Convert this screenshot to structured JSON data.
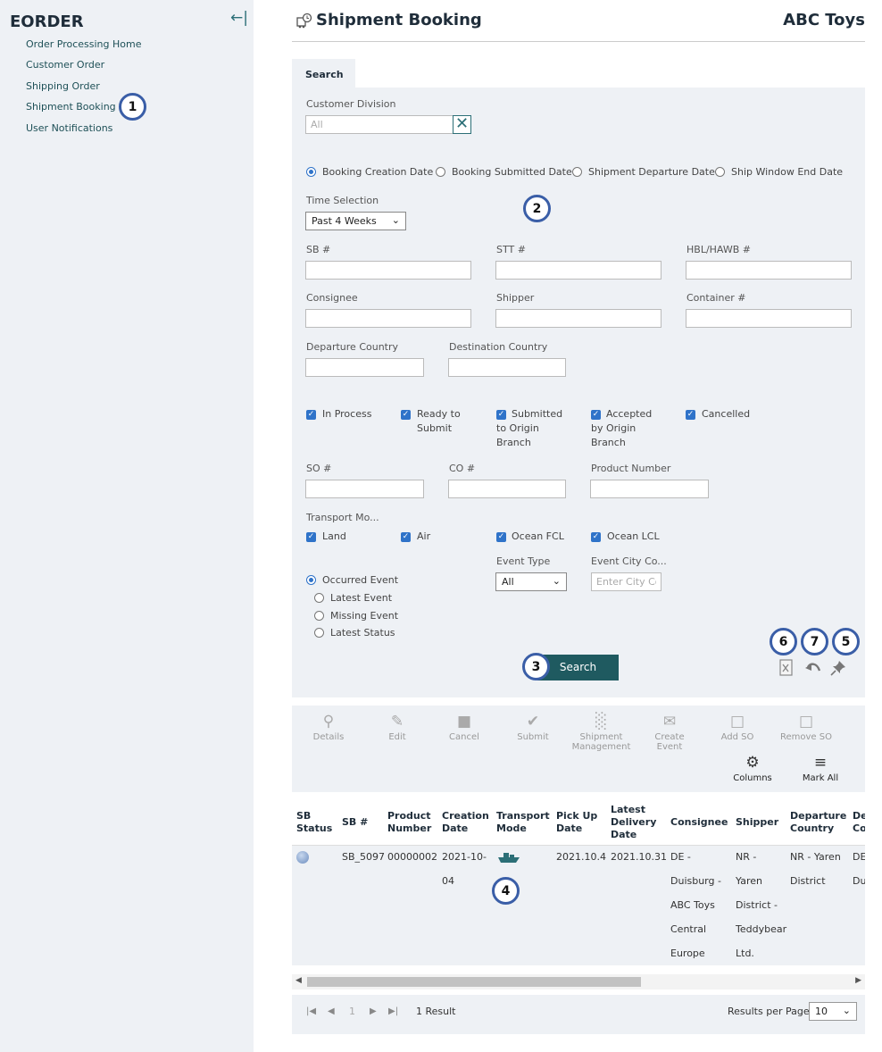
{
  "sidebar": {
    "app_title": "EORDER",
    "items": [
      {
        "label": "Order Processing Home"
      },
      {
        "label": "Customer Order"
      },
      {
        "label": "Shipping Order"
      },
      {
        "label": "Shipment Booking"
      },
      {
        "label": "User Notifications"
      }
    ]
  },
  "header": {
    "title": "Shipment Booking",
    "company": "ABC Toys"
  },
  "tabs": [
    {
      "label": "Search"
    }
  ],
  "form": {
    "customer_division": {
      "label": "Customer Division",
      "placeholder": "All"
    },
    "date_type": {
      "options": [
        "Booking Creation Date",
        "Booking Submitted Date",
        "Shipment Departure Date",
        "Ship Window End Date"
      ],
      "selected": "Booking Creation Date"
    },
    "time_selection": {
      "label": "Time Selection",
      "value": "Past 4 Weeks"
    },
    "fields": {
      "sb": "SB #",
      "stt": "STT #",
      "hbl": "HBL/HAWB #",
      "consignee": "Consignee",
      "shipper": "Shipper",
      "container": "Container #",
      "departure_country": "Departure Country",
      "destination_country": "Destination Country",
      "so": "SO #",
      "co": "CO #",
      "product_number": "Product Number"
    },
    "status_checks": [
      {
        "label": "In Process",
        "checked": true
      },
      {
        "label": "Ready to Submit",
        "checked": true
      },
      {
        "label": "Submitted to Origin Branch",
        "checked": true
      },
      {
        "label": "Accepted by Origin Branch",
        "checked": true
      },
      {
        "label": "Cancelled",
        "checked": true
      }
    ],
    "transport_mode": {
      "label": "Transport Mo...",
      "options": [
        {
          "label": "Land",
          "checked": true
        },
        {
          "label": "Air",
          "checked": true
        },
        {
          "label": "Ocean FCL",
          "checked": true
        },
        {
          "label": "Ocean LCL",
          "checked": true
        }
      ]
    },
    "event": {
      "options": [
        "Occurred Event",
        "Latest Event",
        "Missing Event",
        "Latest Status"
      ],
      "selected": "Occurred Event",
      "type_label": "Event Type",
      "type_value": "All",
      "city_label": "Event City Co...",
      "city_placeholder": "Enter City Co"
    },
    "search_label": "Search"
  },
  "toolbar": {
    "items": [
      {
        "label": "Details",
        "icon": "magnifier-plus-icon"
      },
      {
        "label": "Edit",
        "icon": "pencil-icon"
      },
      {
        "label": "Cancel",
        "icon": "stop-square-icon"
      },
      {
        "label": "Submit",
        "icon": "check-icon"
      },
      {
        "label": "Shipment Management",
        "icon": "bar-chart-icon"
      },
      {
        "label": "Create Event",
        "icon": "envelope-icon"
      },
      {
        "label": "Add SO",
        "icon": "doc-add-icon"
      },
      {
        "label": "Remove SO",
        "icon": "doc-remove-icon"
      }
    ],
    "columns_label": "Columns",
    "mark_all_label": "Mark All"
  },
  "table": {
    "columns": [
      "SB Status",
      "SB #",
      "Product Number",
      "Creation Date",
      "Transport Mode",
      "Pick Up Date",
      "Latest Delivery Date",
      "Consignee",
      "Shipper",
      "Departure Country",
      "De Co"
    ],
    "rows": [
      {
        "sb": "SB_5097",
        "product": "00000002",
        "creation": [
          "2021-10-",
          "04"
        ],
        "transport_icon": "ship-icon",
        "pickup": "2021.10.4",
        "delivery": "2021.10.31",
        "consignee": [
          "DE -",
          "Duisburg -",
          "ABC Toys",
          "Central",
          "Europe"
        ],
        "shipper": [
          "NR -",
          "Yaren",
          "District -",
          "Teddybear",
          "Ltd."
        ],
        "departure": [
          "NR - Yaren",
          "District"
        ],
        "dest": [
          "DE",
          "Du"
        ]
      }
    ]
  },
  "pager": {
    "page": "1",
    "result": "1 Result",
    "per_page_label": "Results per Page",
    "per_page": "10"
  },
  "badges": [
    "1",
    "2",
    "3",
    "4",
    "5",
    "6",
    "7"
  ]
}
